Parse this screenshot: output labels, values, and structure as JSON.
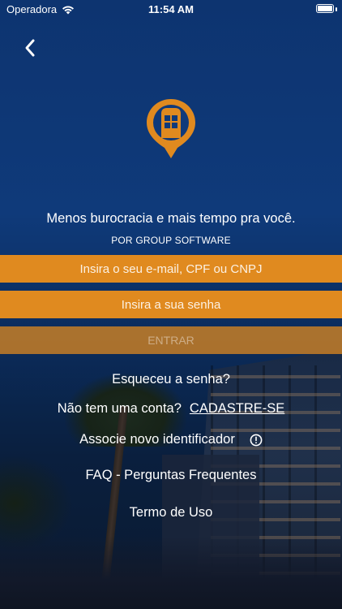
{
  "status_bar": {
    "carrier": "Operadora",
    "time": "11:54 AM",
    "battery_level": 1.0
  },
  "nav": {
    "back_icon": "chevron-left-icon"
  },
  "brand": {
    "logo_icon": "map-pin-door-icon",
    "accent_color": "#e08a1f"
  },
  "header": {
    "tagline": "Menos burocracia e mais tempo pra você.",
    "subtitle": "POR GROUP SOFTWARE"
  },
  "login_form": {
    "email_placeholder": "Insira o seu e-mail, CPF ou CNPJ",
    "email_value": "",
    "password_placeholder": "Insira a sua senha",
    "password_value": "",
    "submit_label": "ENTRAR"
  },
  "links": {
    "forgot_password": "Esqueceu a senha?",
    "no_account": "Não tem uma conta?",
    "register": "CADASTRE-SE",
    "associate_identifier": "Associe novo identificador",
    "associate_info_icon": "info-circle-icon",
    "faq": "FAQ - Perguntas Frequentes",
    "terms": "Termo de Uso"
  }
}
